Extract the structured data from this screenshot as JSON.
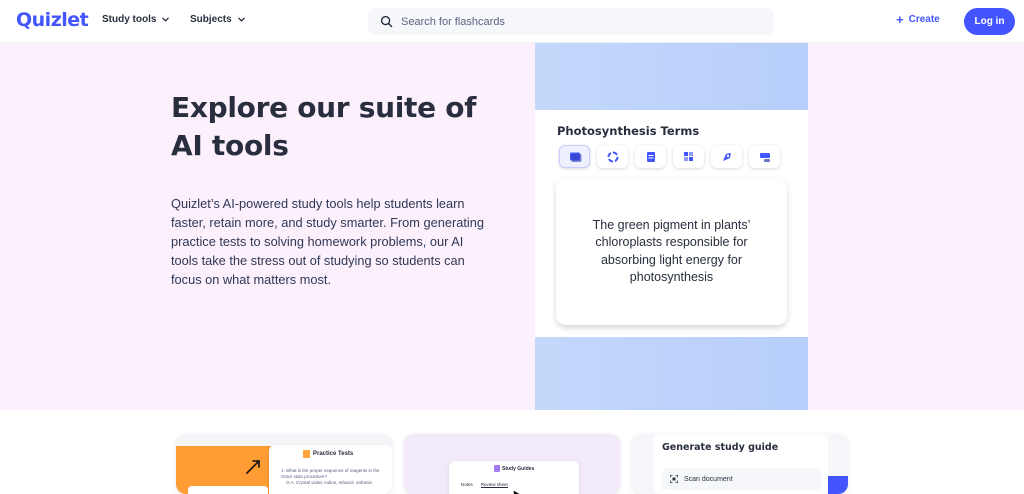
{
  "header": {
    "logo": "Quizlet",
    "nav": [
      {
        "label": "Study tools",
        "icon": "chevron-down-icon"
      },
      {
        "label": "Subjects",
        "icon": "chevron-down-icon"
      }
    ],
    "search_placeholder": "Search for flashcards",
    "create_label": "Create",
    "login_label": "Log in"
  },
  "hero": {
    "title": "Explore our suite of AI tools",
    "description": "Quizlet’s AI-powered study tools help students learn faster, retain more, and study smarter. From generating practice tests to solving homework problems, our AI tools take the stress out of studying so students can focus on what matters most."
  },
  "visual": {
    "set_title": "Photosynthesis Terms",
    "study_modes": [
      "flashcards-icon",
      "learn-icon",
      "test-icon",
      "match-icon",
      "blast-icon",
      "blocks-icon"
    ],
    "flashcard_text": "The green pigment in plants’ chloroplasts responsible for absorbing light energy for photosynthesis"
  },
  "cards": {
    "practice_tests": {
      "title": "Practice Tests",
      "question": "1.  What is the proper sequence of reagents in the Gram stain procedure?",
      "option": "    O A. Crystal violet, iodine, ethanol, safranin"
    },
    "study_guides": {
      "title": "Study Guides",
      "tabs": [
        "Notes",
        "Review sheet"
      ]
    },
    "generate": {
      "title": "Generate study guide",
      "scan_label": "Scan document"
    }
  },
  "colors": {
    "brand": "#4255ff",
    "hero_bg": "#fcf0fc",
    "text": "#282e3e"
  }
}
